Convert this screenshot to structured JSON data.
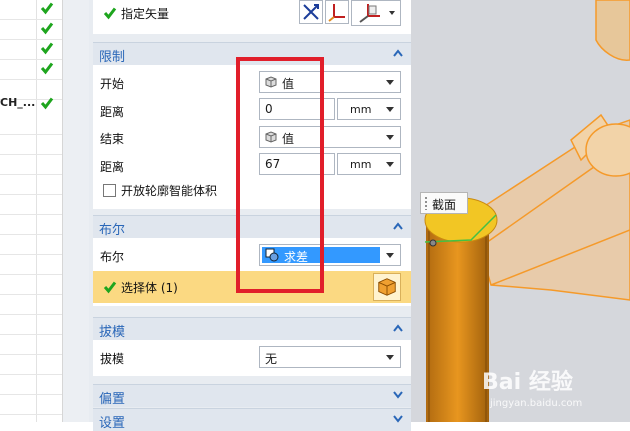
{
  "navigator": {
    "rows": [
      {
        "text": "",
        "checked": true
      },
      {
        "text": "",
        "checked": true
      },
      {
        "text": "",
        "checked": true
      },
      {
        "text": "",
        "checked": true
      },
      {
        "text": "CH_...",
        "checked": true
      }
    ]
  },
  "dialog": {
    "vector_row": {
      "label": "指定矢量"
    },
    "limits": {
      "title": "限制",
      "start_label": "开始",
      "start_value": "值",
      "start_distance_label": "距离",
      "start_distance_value": "0",
      "start_unit": "mm",
      "end_label": "结束",
      "end_value": "值",
      "end_distance_label": "距离",
      "end_distance_value": "67",
      "end_unit": "mm",
      "open_profile_label": "开放轮廓智能体积"
    },
    "boolean": {
      "title": "布尔",
      "boolean_label": "布尔",
      "boolean_value": "求差",
      "select_body_label": "选择体 (1)"
    },
    "draft": {
      "title": "拔模",
      "draft_label": "拔模",
      "draft_value": "无"
    },
    "offset": {
      "title": "偏置"
    },
    "settings": {
      "title": "设置"
    }
  },
  "viewport": {
    "tooltip": "截面"
  },
  "watermark": {
    "logo": "Bai 经验",
    "url": "jingyan.baidu.com"
  },
  "colors": {
    "accent": "#2a67b8",
    "highlight": "#e11e2a",
    "selected": "#3399ff",
    "selection_row": "#fbd982",
    "body_orange": "#f2a64a"
  }
}
